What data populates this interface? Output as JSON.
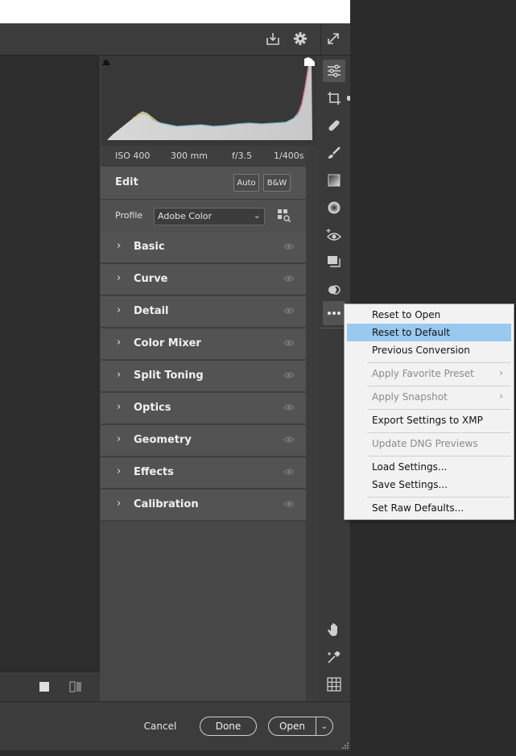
{
  "toolbar": {
    "icons": [
      "save-image-icon",
      "gear-icon",
      "fullscreen-icon"
    ]
  },
  "histogram": {
    "info": {
      "iso": "ISO 400",
      "focal": "300 mm",
      "aperture": "f/3.5",
      "shutter": "1/400s"
    }
  },
  "edit": {
    "title": "Edit",
    "auto_label": "Auto",
    "bw_label": "B&W"
  },
  "profile": {
    "label": "Profile",
    "value": "Adobe Color"
  },
  "sections": [
    {
      "label": "Basic"
    },
    {
      "label": "Curve"
    },
    {
      "label": "Detail"
    },
    {
      "label": "Color Mixer"
    },
    {
      "label": "Split Toning"
    },
    {
      "label": "Optics"
    },
    {
      "label": "Geometry"
    },
    {
      "label": "Effects"
    },
    {
      "label": "Calibration"
    }
  ],
  "context_menu": {
    "items": [
      {
        "label": "Reset to Open",
        "enabled": true
      },
      {
        "label": "Reset to Default",
        "enabled": true,
        "highlighted": true
      },
      {
        "label": "Previous Conversion",
        "enabled": true
      },
      {
        "label": "Apply Favorite Preset",
        "enabled": false,
        "submenu": true
      },
      {
        "label": "Apply Snapshot",
        "enabled": false,
        "submenu": true
      },
      {
        "label": "Export Settings to XMP",
        "enabled": true
      },
      {
        "label": "Update DNG Previews",
        "enabled": false
      },
      {
        "label": "Load Settings...",
        "enabled": true
      },
      {
        "label": "Save Settings...",
        "enabled": true
      },
      {
        "label": "Set Raw Defaults...",
        "enabled": true
      }
    ]
  },
  "footer": {
    "cancel_label": "Cancel",
    "done_label": "Done",
    "open_label": "Open"
  },
  "colors": {
    "highlight": "#99c9ef",
    "panel": "#535353",
    "background": "#2b2b2b"
  }
}
